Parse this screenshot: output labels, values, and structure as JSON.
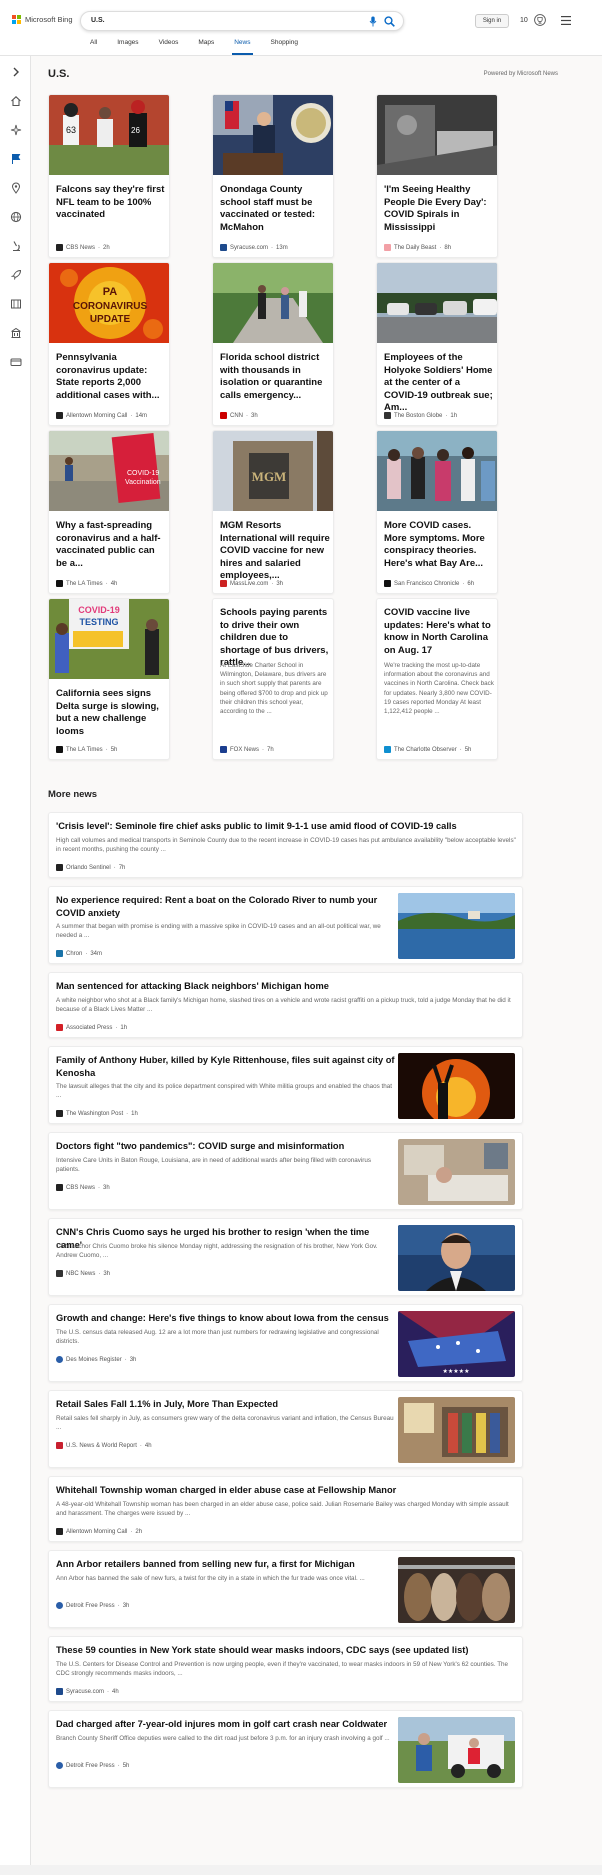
{
  "header": {
    "brand": "Microsoft Bing",
    "search_value": "U.S.",
    "signin_label": "Sign in",
    "rewards_count": "10",
    "tabs": [
      "All",
      "Images",
      "Videos",
      "Maps",
      "News",
      "Shopping"
    ],
    "active_tab": "News",
    "accent_color": "#0b5cad"
  },
  "sidebar": {
    "icons": [
      "chevron-right-icon",
      "home-icon",
      "sparkle-icon",
      "flag-icon",
      "location-icon",
      "globe-icon",
      "microscope-icon",
      "rocket-icon",
      "film-icon",
      "building-icon",
      "money-icon"
    ]
  },
  "section": {
    "title": "U.S.",
    "powered_by": "Powered by Microsoft News"
  },
  "cards": [
    {
      "title": "Falcons say they're first NFL team to be 100% vaccinated",
      "source": "CBS News",
      "age": "2h",
      "icon_color": "#222"
    },
    {
      "title": "Onondaga County school staff must be vaccinated or tested: McMahon",
      "source": "Syracuse.com",
      "age": "13m",
      "icon_color": "#1e4a8c"
    },
    {
      "title": "'I'm Seeing Healthy People Die Every Day': COVID Spirals in Mississippi",
      "source": "The Daily Beast",
      "age": "8h",
      "icon_color": "#e7424a"
    },
    {
      "title": "Pennsylvania coronavirus update: State reports 2,000 additional cases with...",
      "source": "Allentown Morning Call",
      "age": "14m",
      "icon_color": "#222"
    },
    {
      "title": "Florida school district with thousands in isolation or quarantine calls emergency...",
      "source": "CNN",
      "age": "3h",
      "icon_color": "#cc0000"
    },
    {
      "title": "Employees of the Holyoke Soldiers' Home at the center of a COVID-19 outbreak sue; Am...",
      "source": "The Boston Globe",
      "age": "1h",
      "icon_color": "#333"
    },
    {
      "title": "Why a fast-spreading coronavirus and a half-vaccinated public can be a...",
      "source": "The LA Times",
      "age": "4h",
      "icon_color": "#111"
    },
    {
      "title": "MGM Resorts International will require COVID vaccine for new hires and salaried employees,...",
      "source": "MassLive.com",
      "age": "3h",
      "icon_color": "#c22"
    },
    {
      "title": "More COVID cases. More symptoms. More conspiracy theories. Here's what Bay Are...",
      "source": "San Francisco Chronicle",
      "age": "6h",
      "icon_color": "#111"
    },
    {
      "title": "California sees signs Delta surge is slowing, but a new challenge looms",
      "source": "The LA Times",
      "age": "5h",
      "icon_color": "#111"
    },
    {
      "title": "Schools paying parents to drive their own children due to shortage of bus drivers, rattle...",
      "summary": "At EastSide Charter School in Wilmington, Delaware, bus drivers are in such short supply that parents are being offered $700 to drop and pick up their children this school year, according to the ...",
      "source": "FOX News",
      "age": "7h",
      "icon_color": "#1b3e8f"
    },
    {
      "title": "COVID vaccine live updates: Here's what to know in North Carolina on Aug. 17",
      "summary": "We're tracking the most up-to-date information about the coronavirus and vaccines in North Carolina. Check back for updates. Nearly 3,800 new COVID-19 cases reported Monday At least 1,122,412 people ...",
      "source": "The Charlotte Observer",
      "age": "5h",
      "icon_color": "#0f8fd0"
    }
  ],
  "more_news": {
    "title": "More news",
    "items": [
      {
        "title": "'Crisis level': Seminole fire chief asks public to limit 9-1-1 use amid flood of COVID-19 calls",
        "summary": "High call volumes and medical transports in Seminole County due to the recent increase in COVID-19 cases has put ambulance availability \"below acceptable levels\" in recent months, pushing the county ...",
        "source": "Orlando Sentinel",
        "age": "7h",
        "icon_color": "#222",
        "has_thumb": false
      },
      {
        "title": "No experience required: Rent a boat on the Colorado River to numb your COVID anxiety",
        "summary": "A summer that began with promise is ending with a massive spike in COVID-19 cases and an all-out political war, we needed a ...",
        "source": "Chron",
        "age": "34m",
        "icon_color": "#1a73a8",
        "has_thumb": true
      },
      {
        "title": "Man sentenced for attacking Black neighbors' Michigan home",
        "summary": "A white neighbor who shot at a Black family's Michigan home, slashed tires on a vehicle and wrote racist graffiti on a pickup truck, told a judge Monday that he did it because of a Black Lives Matter ...",
        "source": "Associated Press",
        "age": "1h",
        "icon_color": "#d32027",
        "has_thumb": false
      },
      {
        "title": "Family of Anthony Huber, killed by Kyle Rittenhouse, files suit against city of Kenosha",
        "summary": "The lawsuit alleges that the city and its police department conspired with White militia groups and enabled the chaos that ...",
        "source": "The Washington Post",
        "age": "1h",
        "icon_color": "#222",
        "has_thumb": true
      },
      {
        "title": "Doctors fight \"two pandemics\": COVID surge and misinformation",
        "summary": "Intensive Care Units in Baton Rouge, Louisiana, are in need of additional wards after being filled with coronavirus patients.",
        "source": "CBS News",
        "age": "3h",
        "icon_color": "#222",
        "has_thumb": true
      },
      {
        "title": "CNN's Chris Cuomo says he urged his brother to resign 'when the time came'",
        "summary": "CNN anchor Chris Cuomo broke his silence Monday night, addressing the resignation of his brother, New York Gov. Andrew Cuomo, ...",
        "source": "NBC News",
        "age": "3h",
        "icon_color": "#333",
        "has_thumb": true
      },
      {
        "title": "Growth and change: Here's five things to know about Iowa from the census",
        "summary": "The U.S. census data released Aug. 12 are a lot more than just numbers for redrawing legislative and congressional districts.",
        "source": "Des Moines Register",
        "age": "3h",
        "icon_color": "#2a5ea8",
        "has_thumb": true
      },
      {
        "title": "Retail Sales Fall 1.1% in July, More Than Expected",
        "summary": "Retail sales fell sharply in July, as consumers grew wary of the delta coronavirus variant and inflation, the Census Bureau ...",
        "source": "U.S. News & World Report",
        "age": "4h",
        "icon_color": "#c8202f",
        "has_thumb": true
      },
      {
        "title": "Whitehall Township woman charged in elder abuse case at Fellowship Manor",
        "summary": "A 48-year-old Whitehall Township woman has been charged in an elder abuse case, police said. Julian Rosemarie Bailey was charged Monday with simple assault and harassment. The charges were issued by ...",
        "source": "Allentown Morning Call",
        "age": "2h",
        "icon_color": "#222",
        "has_thumb": false
      },
      {
        "title": "Ann Arbor retailers banned from selling new fur, a first for Michigan",
        "summary": "Ann Arbor has banned the sale of new furs, a twist for the city in a state in which the fur trade was once vital. ...",
        "source": "Detroit Free Press",
        "age": "3h",
        "icon_color": "#2a5ea8",
        "has_thumb": true
      },
      {
        "title": "These 59 counties in New York state should wear masks indoors, CDC says (see updated list)",
        "summary": "The U.S. Centers for Disease Control and Prevention is now urging people, even if they're vaccinated, to wear masks indoors in 59 of New York's 62 counties. The CDC strongly recommends masks indoors, ...",
        "source": "Syracuse.com",
        "age": "4h",
        "icon_color": "#1e4a8c",
        "has_thumb": false
      },
      {
        "title": "Dad charged after 7-year-old injures mom in golf cart crash near Coldwater",
        "summary": "Branch County Sheriff Office deputies were called to the dirt road just before 3 p.m. for an injury crash involving a golf ...",
        "source": "Detroit Free Press",
        "age": "5h",
        "icon_color": "#2a5ea8",
        "has_thumb": true
      }
    ]
  }
}
